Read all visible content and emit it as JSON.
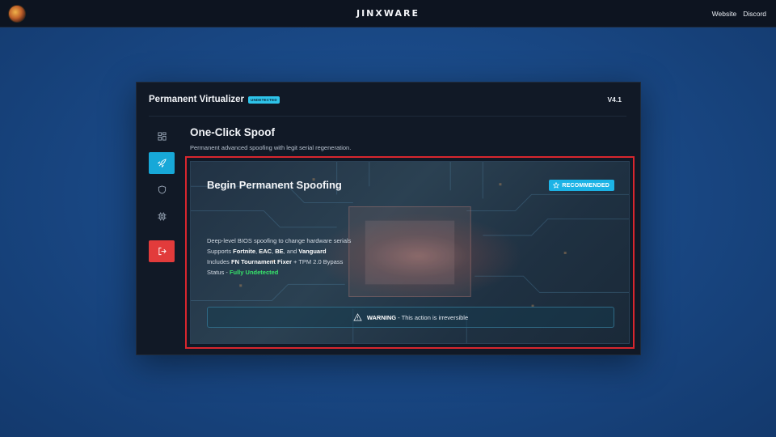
{
  "topbar": {
    "brand": "JINXWARE",
    "links": [
      "Website",
      "Discord"
    ]
  },
  "panel": {
    "title": "Permanent Virtualizer",
    "badge": "UNDETECTED",
    "version": "V4.1"
  },
  "sidebar": {
    "items": [
      {
        "icon": "dashboard-icon",
        "active": false
      },
      {
        "icon": "rocket-icon",
        "active": true
      },
      {
        "icon": "shield-icon",
        "active": false
      },
      {
        "icon": "chip-icon",
        "active": false
      },
      {
        "icon": "logout-icon",
        "danger": true
      }
    ]
  },
  "content": {
    "title": "One-Click Spoof",
    "subtitle": "Permanent advanced spoofing with legit serial regeneration.",
    "card": {
      "title": "Begin Permanent Spoofing",
      "recommended": "RECOMMENDED",
      "line1": "Deep-level BIOS spoofing to change hardware serials",
      "line2_prefix": "Supports ",
      "line2_fortnite": "Fortnite",
      "line2_sep1": ", ",
      "line2_eac": "EAC",
      "line2_sep2": ", ",
      "line2_be": "BE",
      "line2_sep3": ", and ",
      "line2_vanguard": "Vanguard",
      "line3_prefix": "Includes ",
      "line3_fixer": "FN Tournament Fixer",
      "line3_suffix": " + TPM 2.0 Bypass",
      "line4_prefix": "Status - ",
      "line4_status": "Fully Undetected",
      "warning_label": "WARNING",
      "warning_text": " - This action is irreversible"
    }
  },
  "colors": {
    "accent": "#17a8d8",
    "danger": "#e23b3b",
    "status_green": "#37e36a",
    "highlight_border": "#d8262e"
  }
}
